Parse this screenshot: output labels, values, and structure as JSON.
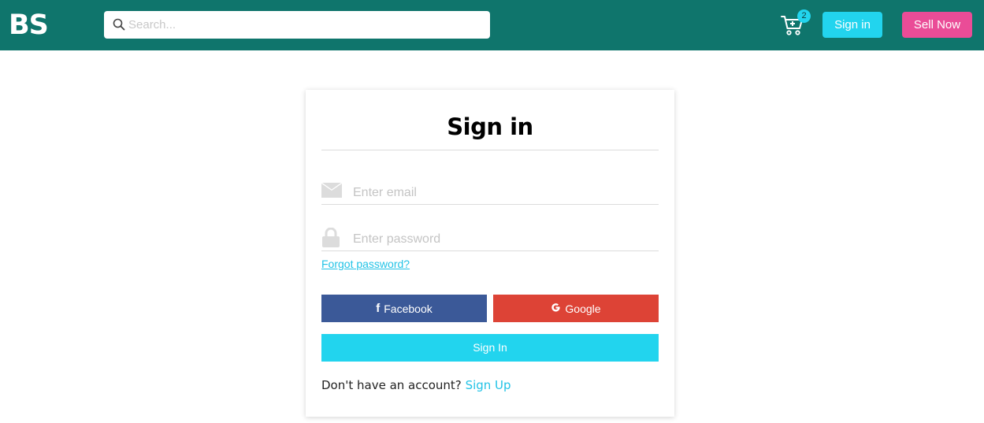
{
  "header": {
    "logo": "BS",
    "search_placeholder": "Search...",
    "cart_count": "2",
    "signin_label": "Sign in",
    "sell_label": "Sell Now"
  },
  "card": {
    "title": "Sign in",
    "email_placeholder": "Enter email",
    "password_placeholder": "Enter password",
    "forgot_label": "Forgot password?",
    "facebook_label": "Facebook",
    "google_label": "Google",
    "signin_button_label": "Sign In",
    "signup_prompt": "Don't have an account?",
    "signup_link": "Sign Up"
  },
  "icons": {
    "search": "search-icon",
    "cart": "cart-icon",
    "email": "envelope-icon",
    "password": "lock-icon",
    "facebook": "facebook-icon",
    "google": "google-icon"
  },
  "colors": {
    "header_bg": "#0f756c",
    "accent": "#22d4ee",
    "sell": "#ea4c97",
    "facebook": "#3b5998",
    "google": "#dd4336",
    "link": "#22c3e6"
  }
}
